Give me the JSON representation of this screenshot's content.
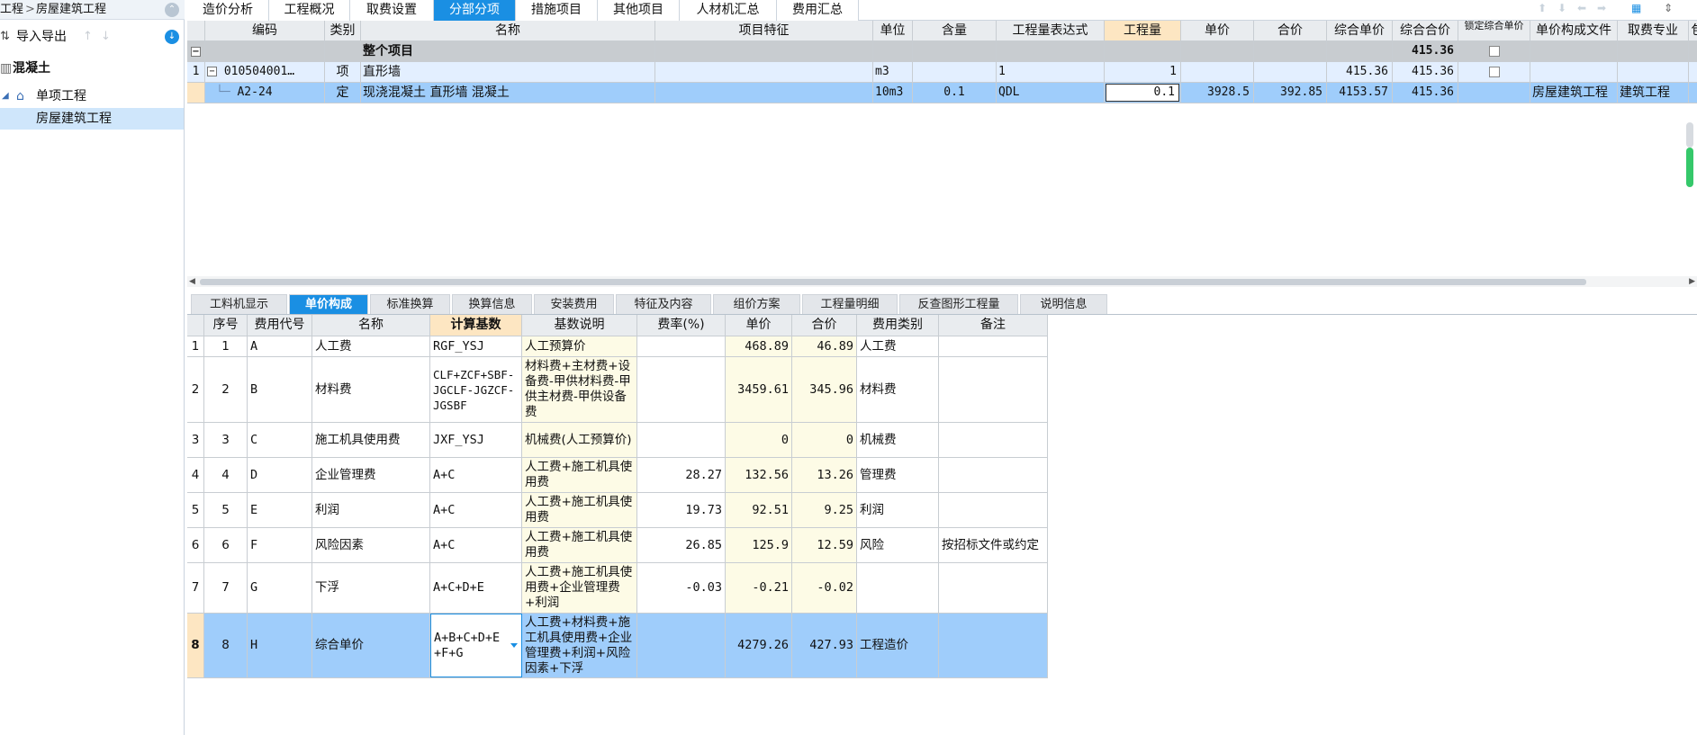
{
  "left_panel": {
    "breadcrumb": [
      "工程",
      "房屋建筑工程"
    ],
    "breadcrumb_sep": ">",
    "import_export_label": "导入导出",
    "tree": {
      "root": "混凝土",
      "level1": "单项工程",
      "level2": "房屋建筑工程"
    }
  },
  "top_tabs": [
    "造价分析",
    "工程概况",
    "取费设置",
    "分部分项",
    "措施项目",
    "其他项目",
    "人材机汇总",
    "费用汇总"
  ],
  "top_tabs_active": "分部分项",
  "upper_grid": {
    "headers": [
      "编码",
      "类别",
      "名称",
      "项目特征",
      "单位",
      "含量",
      "工程量表达式",
      "工程量",
      "单价",
      "合价",
      "综合单价",
      "综合合价",
      "锁定综合单价",
      "单价构成文件",
      "取费专业",
      "包"
    ],
    "total_row": {
      "name": "整个项目",
      "total": "415.36"
    },
    "item_row": {
      "index": "1",
      "code": "010504001…",
      "type": "项",
      "name": "直形墙",
      "unit": "m3",
      "expr": "1",
      "qty": "1",
      "comp_price": "415.36",
      "comp_total": "415.36"
    },
    "sub_row": {
      "code": "A2-24",
      "type": "定",
      "name": "现浇混凝土 直形墙 混凝土",
      "unit": "10m3",
      "content": "0.1",
      "expr": "QDL",
      "qty": "0.1",
      "unit_price": "3928.5",
      "total_price": "392.85",
      "comp_price": "4153.57",
      "comp_total": "415.36",
      "price_file": "房屋建筑工程",
      "fee_major": "建筑工程"
    }
  },
  "bottom_tabs": [
    "工料机显示",
    "单价构成",
    "标准换算",
    "换算信息",
    "安装费用",
    "特征及内容",
    "组价方案",
    "工程量明细",
    "反查图形工程量",
    "说明信息"
  ],
  "bottom_tabs_active": "单价构成",
  "lower_grid": {
    "headers": [
      "序号",
      "费用代号",
      "名称",
      "计算基数",
      "基数说明",
      "费率(%)",
      "单价",
      "合价",
      "费用类别",
      "备注"
    ],
    "rows": [
      {
        "no": "1",
        "seq": "1",
        "code": "A",
        "name": "人工费",
        "base": "RGF_YSJ",
        "desc": "人工预算价",
        "rate": "",
        "price": "468.89",
        "total": "46.89",
        "cat": "人工费",
        "note": ""
      },
      {
        "no": "2",
        "seq": "2",
        "code": "B",
        "name": "材料费",
        "base": "CLF+ZCF+SBF-JGCLF-JGZCF-JGSBF",
        "desc": "材料费+主材费+设备费-甲供材料费-甲供主材费-甲供设备费",
        "rate": "",
        "price": "3459.61",
        "total": "345.96",
        "cat": "材料费",
        "note": ""
      },
      {
        "no": "3",
        "seq": "3",
        "code": "C",
        "name": "施工机具使用费",
        "base": "JXF_YSJ",
        "desc": "机械费(人工预算价)",
        "rate": "",
        "price": "0",
        "total": "0",
        "cat": "机械费",
        "note": ""
      },
      {
        "no": "4",
        "seq": "4",
        "code": "D",
        "name": "企业管理费",
        "base": "A+C",
        "desc": "人工费+施工机具使用费",
        "rate": "28.27",
        "price": "132.56",
        "total": "13.26",
        "cat": "管理费",
        "note": ""
      },
      {
        "no": "5",
        "seq": "5",
        "code": "E",
        "name": "利润",
        "base": "A+C",
        "desc": "人工费+施工机具使用费",
        "rate": "19.73",
        "price": "92.51",
        "total": "9.25",
        "cat": "利润",
        "note": ""
      },
      {
        "no": "6",
        "seq": "6",
        "code": "F",
        "name": "风险因素",
        "base": "A+C",
        "desc": "人工费+施工机具使用费",
        "rate": "26.85",
        "price": "125.9",
        "total": "12.59",
        "cat": "风险",
        "note": "按招标文件或约定"
      },
      {
        "no": "7",
        "seq": "7",
        "code": "G",
        "name": "下浮",
        "base": "A+C+D+E",
        "desc": "人工费+施工机具使用费+企业管理费+利润",
        "rate": "-0.03",
        "price": "-0.21",
        "total": "-0.02",
        "cat": "",
        "note": ""
      },
      {
        "no": "8",
        "seq": "8",
        "code": "H",
        "name": "综合单价",
        "base": "A+B+C+D+E+F+G",
        "desc": "人工费+材料费+施工机具使用费+企业管理费+利润+风险因素+下浮",
        "rate": "",
        "price": "4279.26",
        "total": "427.93",
        "cat": "工程造价",
        "note": ""
      }
    ]
  },
  "colors": {
    "accent": "#1a8fe3",
    "selected_row": "#9fcdfb",
    "header_highlight": "#fde6c2"
  }
}
